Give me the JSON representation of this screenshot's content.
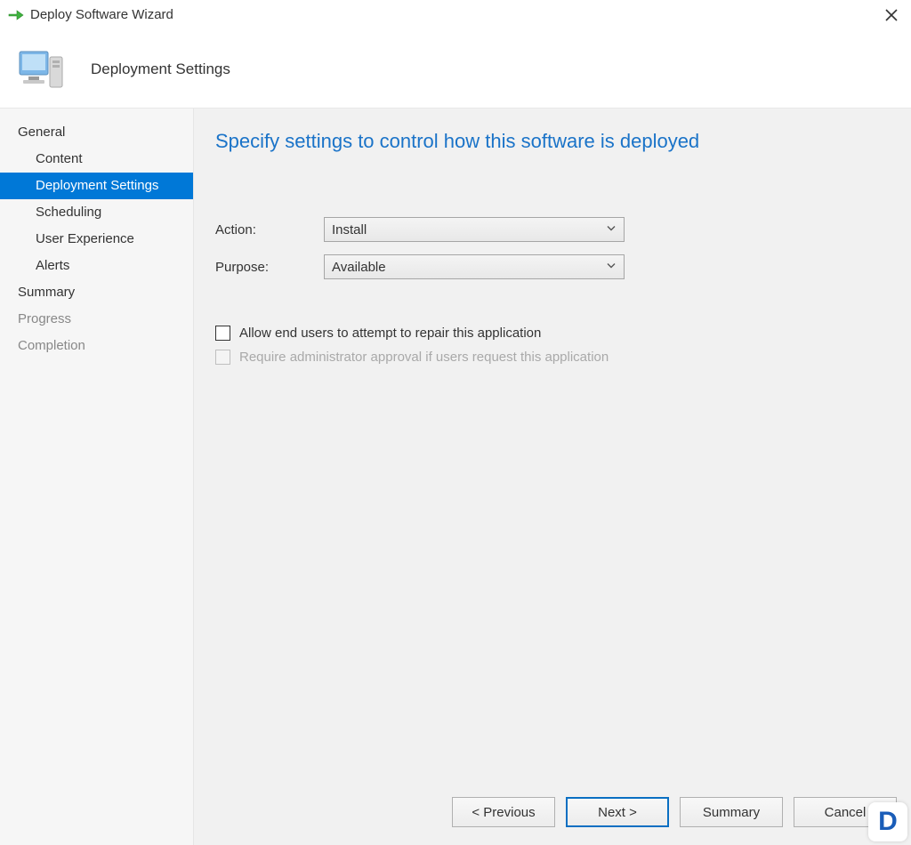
{
  "titlebar": {
    "title": "Deploy Software Wizard"
  },
  "header": {
    "title": "Deployment Settings"
  },
  "sidebar": {
    "items": [
      {
        "label": "General",
        "sub": false,
        "selected": false
      },
      {
        "label": "Content",
        "sub": true,
        "selected": false
      },
      {
        "label": "Deployment Settings",
        "sub": true,
        "selected": true
      },
      {
        "label": "Scheduling",
        "sub": true,
        "selected": false
      },
      {
        "label": "User Experience",
        "sub": true,
        "selected": false
      },
      {
        "label": "Alerts",
        "sub": true,
        "selected": false
      },
      {
        "label": "Summary",
        "sub": false,
        "selected": false
      },
      {
        "label": "Progress",
        "sub": false,
        "selected": false,
        "disabled": true
      },
      {
        "label": "Completion",
        "sub": false,
        "selected": false,
        "disabled": true
      }
    ]
  },
  "content": {
    "heading": "Specify settings to control how this software is deployed",
    "action_label": "Action:",
    "action_value": "Install",
    "purpose_label": "Purpose:",
    "purpose_value": "Available",
    "checkbox_repair": "Allow end users to attempt to repair this application",
    "checkbox_admin": "Require administrator approval if users request this application"
  },
  "buttons": {
    "previous": "< Previous",
    "next": "Next >",
    "summary": "Summary",
    "cancel": "Cancel"
  }
}
